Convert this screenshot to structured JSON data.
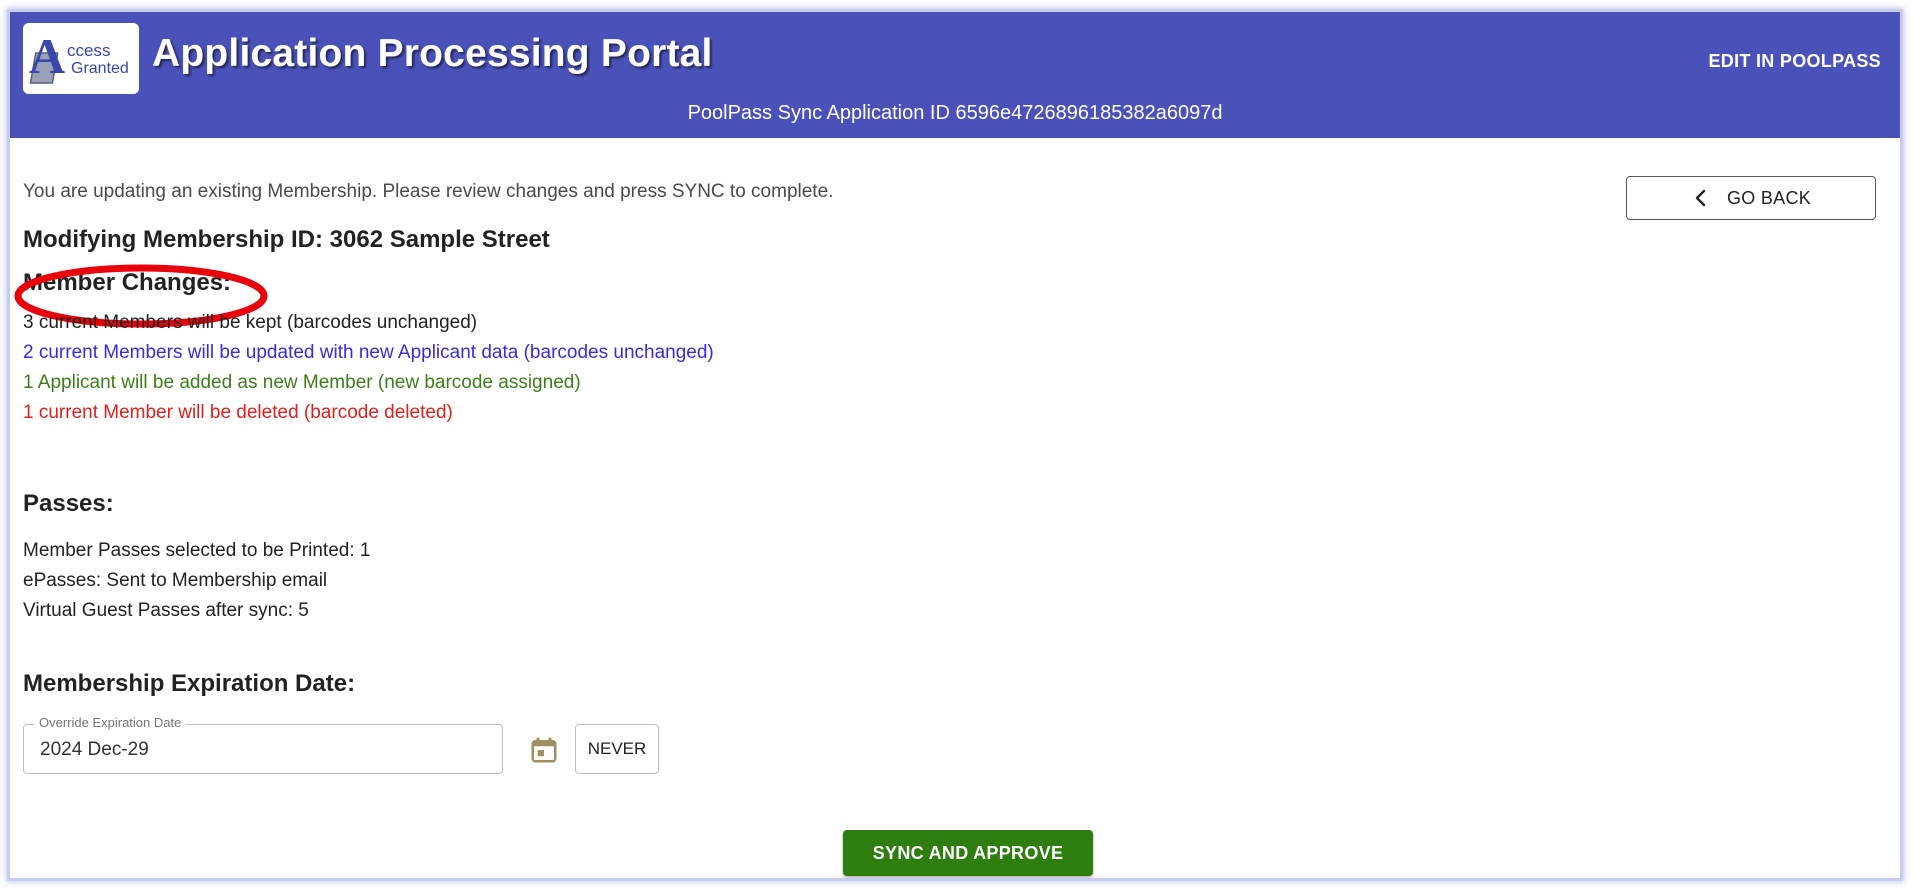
{
  "header": {
    "logo_text_line1": "ccess",
    "logo_text_line2": "Granted",
    "logo_letter": "A",
    "title": "Application Processing Portal",
    "edit_link": "EDIT IN POOLPASS",
    "sync_id": "PoolPass Sync Application ID 6596e4726896185382a6097d"
  },
  "intro": "You are updating an existing Membership. Please review changes and press SYNC to complete.",
  "go_back_label": "GO BACK",
  "modifying_title": "Modifying Membership ID: 3062 Sample Street",
  "member_changes": {
    "title": "Member Changes:",
    "kept": "3 current Members will be kept (barcodes unchanged)",
    "updated": "2 current Members will be updated with new Applicant data (barcodes unchanged)",
    "added": "1 Applicant will be added as new Member (new barcode assigned)",
    "deleted": "1 current Member will be deleted (barcode deleted)"
  },
  "passes": {
    "title": "Passes:",
    "printed": "Member Passes selected to be Printed: 1",
    "epasses": "ePasses: Sent to Membership email",
    "virtual_guest": "Virtual Guest Passes after sync: 5"
  },
  "expiration": {
    "title": "Membership Expiration Date:",
    "field_label": "Override Expiration Date",
    "field_value": "2024 Dec-29",
    "never_label": "NEVER"
  },
  "sync_button": "SYNC AND APPROVE",
  "colors": {
    "header_bg": "#4a52b9",
    "kept": "#222222",
    "updated": "#3a2be0",
    "added": "#3e7d1c",
    "deleted": "#e0201c",
    "sync_button": "#2e7d0f",
    "highlight_ellipse": "#e8000b",
    "calendar_icon": "#a09060"
  },
  "icons": {
    "back": "chevron-left-icon",
    "calendar": "calendar-icon"
  }
}
